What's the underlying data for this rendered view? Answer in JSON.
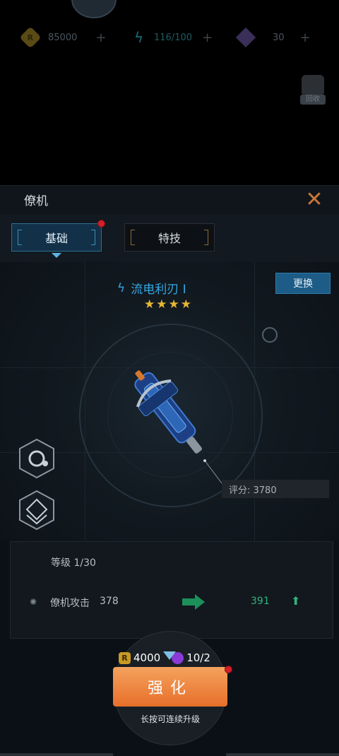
{
  "resources": {
    "coin": {
      "icon": "coin-icon",
      "value": "85000"
    },
    "energy": {
      "icon": "lightning-icon",
      "value": "116/100"
    },
    "gem": {
      "icon": "gem-icon",
      "value": "30"
    },
    "plus": "+"
  },
  "recycle": {
    "label": "回收"
  },
  "panel": {
    "title": "僚机",
    "close": "✕"
  },
  "tabs": [
    {
      "label": "基础"
    },
    {
      "label": "特技"
    }
  ],
  "weapon": {
    "name": "流电利刃 I",
    "stars": "★★★★",
    "swap_label": "更换",
    "score": "评分: 3780"
  },
  "stats": {
    "level": "等级 1/30",
    "attack_label": "僚机攻击",
    "attack_value": "378",
    "attack_new": "391"
  },
  "upgrade": {
    "cost_coin": "4000",
    "cost_item": "10/2",
    "button": "强化",
    "hint": "长按可连续升级"
  },
  "colors": {
    "accent": "#35a7e2",
    "button": "#e86f2a",
    "stat_up": "#35b37c"
  }
}
